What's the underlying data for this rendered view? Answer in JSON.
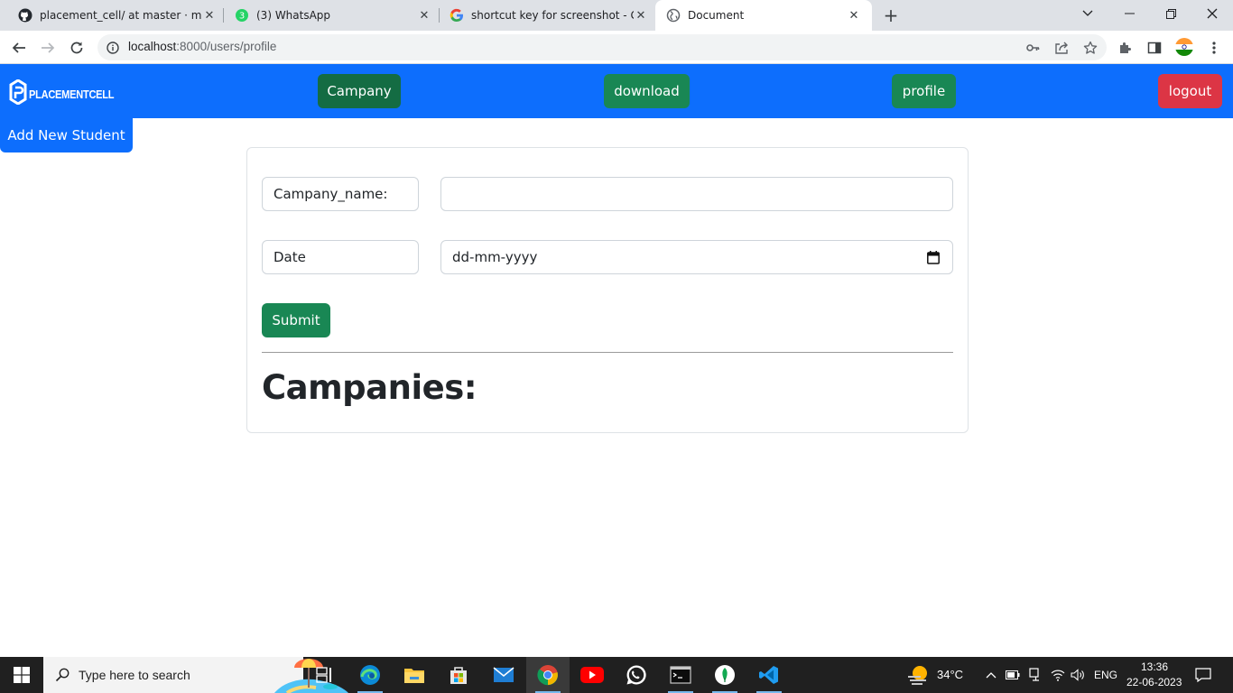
{
  "browser": {
    "tabs": [
      {
        "title": "placement_cell/ at master · mpal",
        "icon": "github-icon"
      },
      {
        "title": "(3) WhatsApp",
        "icon": "whatsapp-badge-icon",
        "badge": "3"
      },
      {
        "title": "shortcut key for screenshot - Goo",
        "icon": "google-icon"
      },
      {
        "title": "Document",
        "icon": "globe-icon",
        "active": true
      }
    ],
    "url_host": "localhost",
    "url_path": ":8000/users/profile"
  },
  "navbar": {
    "brand": "PLACEMENTCELL",
    "campany": "Campany",
    "download": "download",
    "profile": "profile",
    "logout": "logout"
  },
  "add_new_student": "Add New Student",
  "form": {
    "company_label": "Campany_name:",
    "company_value": "",
    "date_label": "Date",
    "date_placeholder": "dd-mm-yyyy",
    "submit": "Submit"
  },
  "list_heading": "Campanies:",
  "taskbar": {
    "search_placeholder": "Type here to search",
    "temperature": "34°C",
    "language": "ENG",
    "time": "13:36",
    "date": "22-06-2023"
  },
  "colors": {
    "primary": "#0d6efd",
    "success": "#198754",
    "danger": "#dc3545"
  }
}
